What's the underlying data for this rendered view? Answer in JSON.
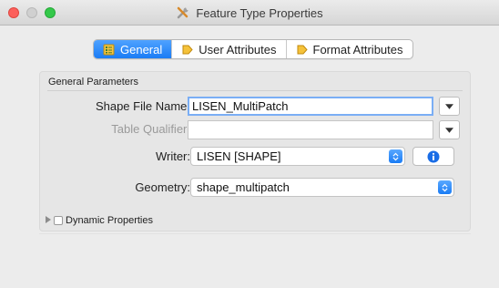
{
  "window": {
    "title": "Feature Type Properties",
    "title_icon": "wrench-screwdriver-icon"
  },
  "tabs": [
    {
      "label": "General",
      "icon": "general-tab-icon",
      "active": true
    },
    {
      "label": "User Attributes",
      "icon": "diamond-arrow-icon",
      "active": false
    },
    {
      "label": "Format Attributes",
      "icon": "diamond-arrow-icon",
      "active": false
    }
  ],
  "general_parameters": {
    "section_title": "General Parameters",
    "shape_file_name": {
      "label": "Shape File Name:",
      "value": "LISEN_MultiPatch"
    },
    "table_qualifier": {
      "label": "Table Qualifier:",
      "value": ""
    },
    "writer": {
      "label": "Writer:",
      "value": "LISEN [SHAPE]"
    },
    "geometry": {
      "label": "Geometry:",
      "value": "shape_multipatch"
    }
  },
  "dynamic_properties": {
    "label": "Dynamic Properties",
    "checked": false,
    "expanded": false
  },
  "colors": {
    "accent_blue": "#1a7cf5",
    "close": "#fc605c",
    "maximize": "#34c84a"
  }
}
